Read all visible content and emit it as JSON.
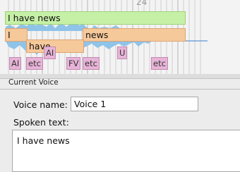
{
  "timeline": {
    "ruler_label": "24",
    "voice_bar_label": "I have news",
    "word_bars": [
      "I",
      "news",
      "have"
    ],
    "phonemes": [
      "AI",
      "etc",
      "FV",
      "etc",
      "etc"
    ],
    "phonemes_mid": [
      "AI",
      "U"
    ]
  },
  "panel": {
    "title": "Current Voice",
    "voice_name_label": "Voice name:",
    "voice_name_value": "Voice 1",
    "spoken_text_label": "Spoken text:",
    "spoken_text_value": "I have news"
  },
  "colors": {
    "voice_bar": "#c6f0a6",
    "word_bar": "#f6c99b",
    "phoneme": "#e7b4d7",
    "waveform": "#8fc3e8"
  }
}
